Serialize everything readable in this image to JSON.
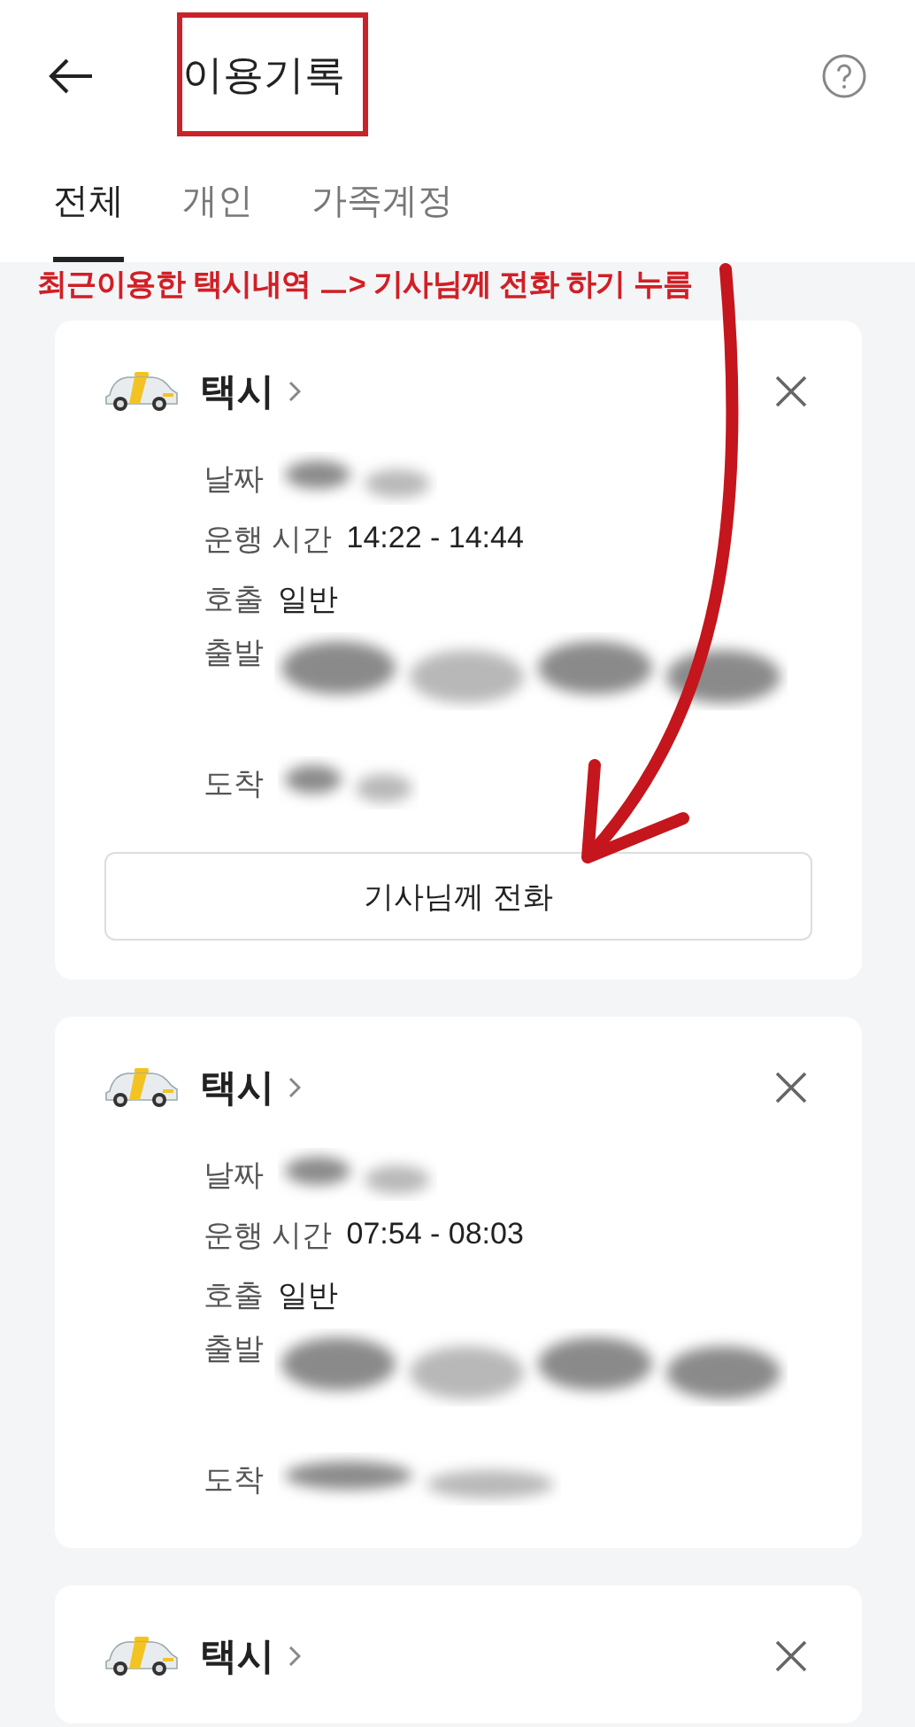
{
  "header": {
    "title": "이용기록"
  },
  "tabs": [
    {
      "label": "전체",
      "selected": true
    },
    {
      "label": "개인",
      "selected": false
    },
    {
      "label": "가족계정",
      "selected": false
    }
  ],
  "annotation": {
    "text": "최근이용한 택시내역 ㅡ> 기사님께 전화 하기 누름"
  },
  "trips": [
    {
      "service": "택시",
      "details": [
        {
          "kind": "redacted",
          "label": "날짜"
        },
        {
          "kind": "text",
          "label": "운행 시간",
          "value": "14:22 - 14:44"
        },
        {
          "kind": "text",
          "label": "호출",
          "value": "일반"
        },
        {
          "kind": "redacted_wide",
          "label": "출발"
        },
        {
          "kind": "redacted",
          "label": "도착"
        }
      ],
      "call_button": "기사님께 전화"
    },
    {
      "service": "택시",
      "details": [
        {
          "kind": "redacted",
          "label": "날짜"
        },
        {
          "kind": "text",
          "label": "운행 시간",
          "value": "07:54 - 08:03"
        },
        {
          "kind": "text",
          "label": "호출",
          "value": "일반"
        },
        {
          "kind": "redacted_wide",
          "label": "출발"
        },
        {
          "kind": "redacted",
          "label": "도착"
        }
      ]
    },
    {
      "service": "택시"
    }
  ]
}
